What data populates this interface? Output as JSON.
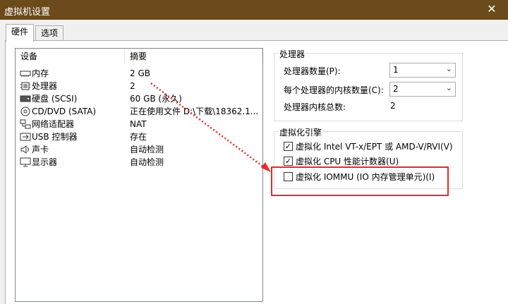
{
  "window": {
    "title": "虚拟机设置",
    "close_glyph": "✕"
  },
  "tabs": [
    {
      "label": "硬件"
    },
    {
      "label": "选项"
    }
  ],
  "device_list": {
    "col_device": "设备",
    "col_summary": "摘要",
    "items": [
      {
        "name": "内存",
        "summary": "2 GB",
        "icon": "memory-icon"
      },
      {
        "name": "处理器",
        "summary": "2",
        "icon": "processor-icon"
      },
      {
        "name": "硬盘 (SCSI)",
        "summary": "60 GB (永久)",
        "icon": "harddisk-icon"
      },
      {
        "name": "CD/DVD (SATA)",
        "summary": "正在使用文件 D:\\下载\\18362.1...",
        "icon": "cd-dvd-icon"
      },
      {
        "name": "网络适配器",
        "summary": "NAT",
        "icon": "network-adapter-icon"
      },
      {
        "name": "USB 控制器",
        "summary": "存在",
        "icon": "usb-icon"
      },
      {
        "name": "声卡",
        "summary": "自动检测",
        "icon": "sound-card-icon"
      },
      {
        "name": "显示器",
        "summary": "自动检测",
        "icon": "display-icon"
      }
    ]
  },
  "processor": {
    "group_title": "处理器",
    "num_processors_label": "处理器数量(P):",
    "num_processors_value": "1",
    "cores_per_processor_label": "每个处理器的内核数量(C):",
    "cores_per_processor_value": "2",
    "total_cores_label": "处理器内核总数:",
    "total_cores_value": "2"
  },
  "virtualization": {
    "group_title": "虚拟化引擎",
    "options": [
      {
        "label": "虚拟化 Intel VT-x/EPT 或 AMD-V/RVI(V)",
        "checked": true
      },
      {
        "label": "虚拟化 CPU 性能计数器(U)",
        "checked": true
      },
      {
        "label": "虚拟化 IOMMU (IO 内存管理单元)(I)",
        "checked": false
      }
    ]
  },
  "colors": {
    "titlebar": "#6b4a1c",
    "annotation": "#e52a2a"
  }
}
